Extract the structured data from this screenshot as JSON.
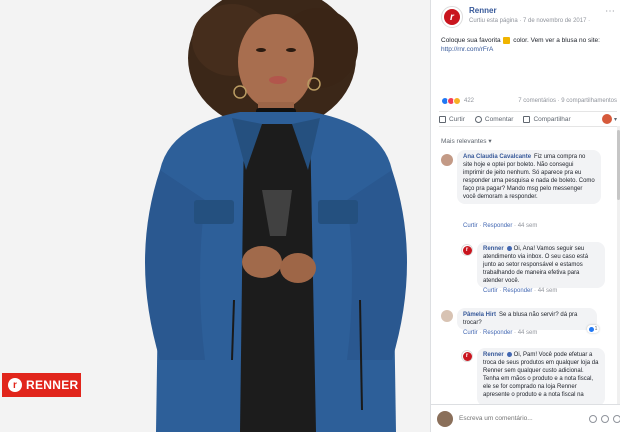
{
  "post": {
    "page_name": "Renner",
    "meta": "Curtiu esta página · 7 de novembro de 2017 · ",
    "text_part1": "Coloque sua favorita",
    "text_part2": "color. Vem ver a blusa no site:",
    "link": "http://rnr.com/rFrA",
    "reactions_count": "422",
    "stats": "7 comentários · 9 compartilhamentos",
    "actions": {
      "like": "Curtir",
      "comment": "Comentar",
      "share": "Compartilhar"
    },
    "sort_label": "Mais relevantes ▾"
  },
  "brand_logo_text": "RENNER",
  "comments": [
    {
      "author": "Ana Claudia Cavalcante",
      "text": "Fiz uma compra no site hoje e optei por boleto. Não consegui imprimir de jeito nenhum. Só aparece pra eu responder uma pesquisa e nada de boleto. Como faço pra pagar? Mando msg pelo messenger você demoram a responder.",
      "like": "Curtir",
      "reply": "Responder",
      "time": "44 sem"
    },
    {
      "author": "Renner",
      "text": "Oi, Ana! Vamos seguir seu atendimento via inbox. O seu caso está junto ao setor responsável e estamos trabalhando de maneira efetiva para atender você.",
      "like": "Curtir",
      "reply": "Responder",
      "time": "44 sem"
    },
    {
      "author": "Pâmela Hirt",
      "text": "Se a blusa não servir? dá pra trocar?",
      "like": "Curtir",
      "reply": "Responder",
      "time": "44 sem",
      "likes": "1"
    },
    {
      "author": "Renner",
      "text": "Oi, Pam! Você pode efetuar a troca de seus produtos em qualquer loja da Renner sem qualquer custo adicional. Tenha em mãos o produto e a nota fiscal, ele se for comprado na loja Renner apresente o produto e a nota fiscal na"
    }
  ],
  "composer": {
    "placeholder": "Escreva um comentário..."
  },
  "colors": {
    "brand_red": "#e1251b",
    "link_blue": "#365899",
    "bubble_gray": "#f2f3f5"
  },
  "icons": [
    "more-dots-icon",
    "like-icon",
    "comment-icon",
    "share-icon",
    "emoji-icon",
    "camera-icon",
    "gif-icon"
  ]
}
